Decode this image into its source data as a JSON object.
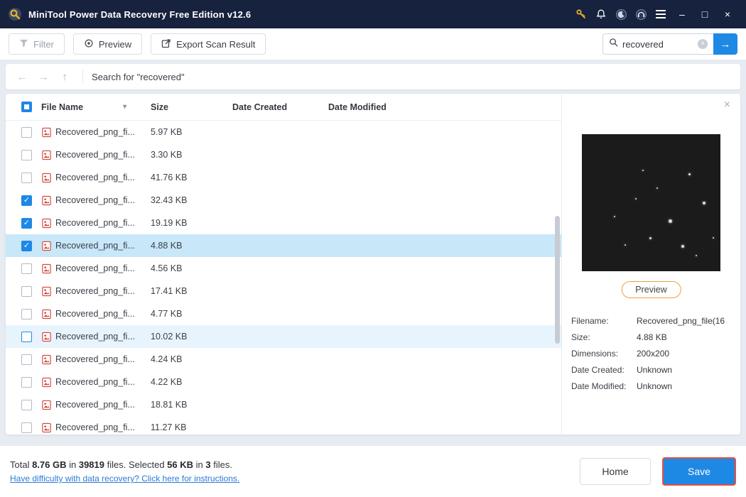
{
  "titlebar": {
    "title": "MiniTool Power Data Recovery Free Edition v12.6"
  },
  "toolbar": {
    "filter": "Filter",
    "preview": "Preview",
    "export": "Export Scan Result",
    "search_value": "recovered"
  },
  "navbar": {
    "search_status": "Search for  \"recovered\""
  },
  "table": {
    "headers": [
      "File Name",
      "Size",
      "Date Created",
      "Date Modified"
    ],
    "rows": [
      {
        "name": "Recovered_png_fi...",
        "size": "5.97 KB",
        "checked": false,
        "highlight": "none"
      },
      {
        "name": "Recovered_png_fi...",
        "size": "3.30 KB",
        "checked": false,
        "highlight": "none"
      },
      {
        "name": "Recovered_png_fi...",
        "size": "41.76 KB",
        "checked": false,
        "highlight": "none"
      },
      {
        "name": "Recovered_png_fi...",
        "size": "32.43 KB",
        "checked": true,
        "highlight": "none"
      },
      {
        "name": "Recovered_png_fi...",
        "size": "19.19 KB",
        "checked": true,
        "highlight": "none"
      },
      {
        "name": "Recovered_png_fi...",
        "size": "4.88 KB",
        "checked": true,
        "highlight": "selected"
      },
      {
        "name": "Recovered_png_fi...",
        "size": "4.56 KB",
        "checked": false,
        "highlight": "none"
      },
      {
        "name": "Recovered_png_fi...",
        "size": "17.41 KB",
        "checked": false,
        "highlight": "none"
      },
      {
        "name": "Recovered_png_fi...",
        "size": "4.77 KB",
        "checked": false,
        "highlight": "none"
      },
      {
        "name": "Recovered_png_fi...",
        "size": "10.02 KB",
        "checked": false,
        "highlight": "hover"
      },
      {
        "name": "Recovered_png_fi...",
        "size": "4.24 KB",
        "checked": false,
        "highlight": "none"
      },
      {
        "name": "Recovered_png_fi...",
        "size": "4.22 KB",
        "checked": false,
        "highlight": "none"
      },
      {
        "name": "Recovered_png_fi...",
        "size": "18.81 KB",
        "checked": false,
        "highlight": "none"
      },
      {
        "name": "Recovered_png_fi...",
        "size": "11.27 KB",
        "checked": false,
        "highlight": "none"
      }
    ]
  },
  "preview_panel": {
    "preview_button": "Preview",
    "info": [
      {
        "label": "Filename:",
        "value": "Recovered_png_file(16"
      },
      {
        "label": "Size:",
        "value": "4.88 KB"
      },
      {
        "label": "Dimensions:",
        "value": "200x200"
      },
      {
        "label": "Date Created:",
        "value": "Unknown"
      },
      {
        "label": "Date Modified:",
        "value": "Unknown"
      }
    ]
  },
  "footer": {
    "summary": [
      {
        "text": "Total ",
        "bold": false
      },
      {
        "text": "8.76 GB",
        "bold": true
      },
      {
        "text": " in ",
        "bold": false
      },
      {
        "text": "39819",
        "bold": true
      },
      {
        "text": " files.  Selected ",
        "bold": false
      },
      {
        "text": "56 KB",
        "bold": true
      },
      {
        "text": " in ",
        "bold": false
      },
      {
        "text": "3",
        "bold": true
      },
      {
        "text": " files.",
        "bold": false
      }
    ],
    "help_link": "Have difficulty with data recovery? Click here for instructions.",
    "home": "Home",
    "save": "Save"
  },
  "colors": {
    "accent_blue": "#1e88e5",
    "titlebar_bg": "#16223e",
    "selected_row": "#c8e7f9",
    "hover_row": "#e8f4fd",
    "save_border": "#e8503a",
    "preview_btn_border": "#e8a33d",
    "link_blue": "#2b7bd6"
  }
}
